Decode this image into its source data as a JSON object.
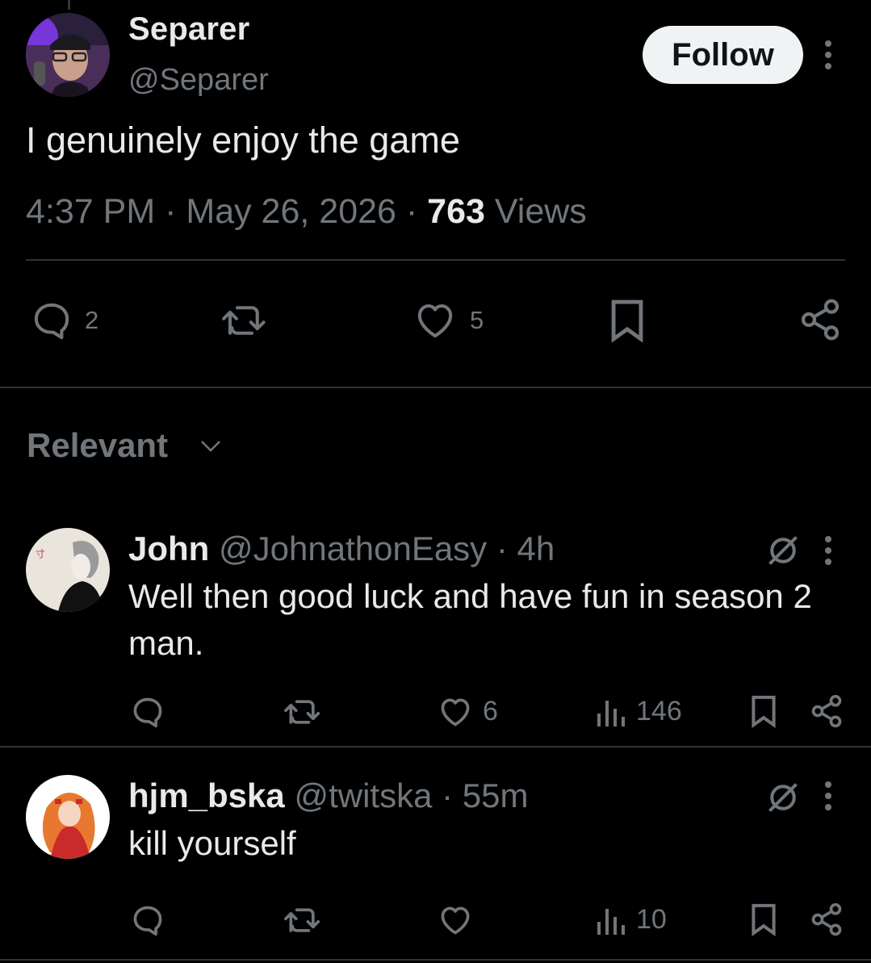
{
  "tweet": {
    "author_name": "Separer",
    "author_handle": "@Separer",
    "follow_label": "Follow",
    "text": "I genuinely enjoy the game",
    "time": "4:37 PM",
    "sep1": "·",
    "date": "May 26, 2026",
    "sep2": "·",
    "views_count": "763",
    "views_label": "Views",
    "actions": {
      "reply_count": "2",
      "like_count": "5"
    }
  },
  "sort": {
    "label": "Relevant"
  },
  "replies": [
    {
      "name": "John",
      "handle": "@JohnathonEasy",
      "sep": "·",
      "time": "4h",
      "text": "Well then good luck and have fun in season 2 man.",
      "like_count": "6",
      "view_count": "146"
    },
    {
      "name": "hjm_bska",
      "handle": "@twitska",
      "sep": "·",
      "time": "55m",
      "text": "kill yourself",
      "like_count": "",
      "view_count": "10"
    }
  ],
  "colors": {
    "background": "#000000",
    "text": "#e7e9ea",
    "secondary": "#71767b",
    "divider": "#2f3336",
    "follow_bg": "#eff3f4"
  },
  "icons": [
    "reply-icon",
    "retweet-icon",
    "like-icon",
    "bookmark-icon",
    "share-icon",
    "views-icon",
    "more-icon",
    "grok-icon",
    "chevron-down-icon"
  ]
}
